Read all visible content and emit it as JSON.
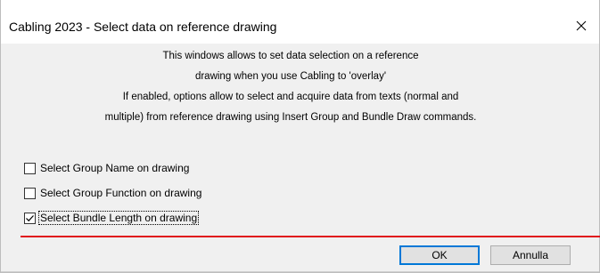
{
  "window": {
    "title": "Cabling 2023 - Select data on reference drawing"
  },
  "description": {
    "lines": [
      "This windows allows to set data selection on a reference",
      "drawing when you use Cabling to 'overlay'",
      "If enabled, options allow to select and acquire data from texts (normal and",
      "multiple) from reference drawing using Insert Group and Bundle Draw commands."
    ]
  },
  "options": [
    {
      "label": "Select Group Name on drawing",
      "checked": false
    },
    {
      "label": "Select Group Function on drawing",
      "checked": false
    },
    {
      "label": "Select Bundle Length on drawing",
      "checked": true
    }
  ],
  "buttons": {
    "ok_label": "OK",
    "cancel_label": "Annulla"
  },
  "icons": {
    "close": "close-icon",
    "check": "check-icon"
  },
  "colors": {
    "separator_red": "#e0141c",
    "default_button_border": "#0078d7",
    "dialog_background": "#f0f0f0"
  }
}
